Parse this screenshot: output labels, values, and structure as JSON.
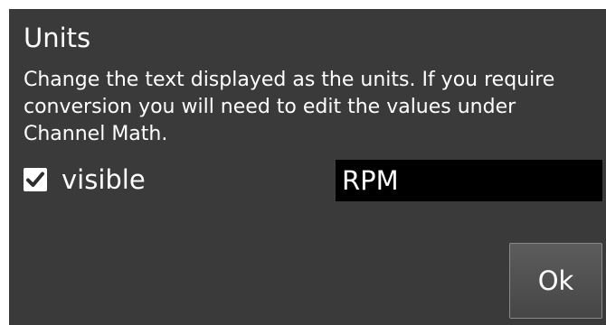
{
  "dialog": {
    "title": "Units",
    "description": "Change the text displayed as the units. If you require conversion you will need to edit the values under Channel Math.",
    "visible_checkbox": {
      "label": "visible",
      "checked": true
    },
    "units_field": {
      "value": "RPM"
    },
    "ok_label": "Ok"
  },
  "colors": {
    "dialog_background": "#3a3a3a",
    "input_background": "#000000",
    "text": "#ffffff"
  }
}
